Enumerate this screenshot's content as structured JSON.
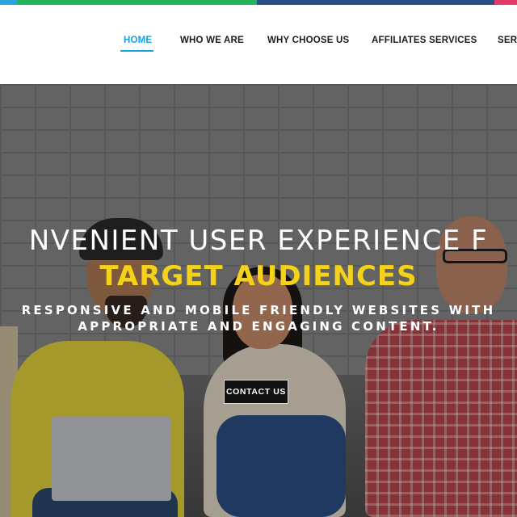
{
  "nav": {
    "items": [
      {
        "label": "HOME",
        "active": true
      },
      {
        "label": "WHO WE ARE",
        "active": false
      },
      {
        "label": "WHY CHOOSE US",
        "active": false
      },
      {
        "label": "AFFILIATES SERVICES",
        "active": false
      },
      {
        "label": "SERV",
        "active": false
      }
    ]
  },
  "hero": {
    "headline": "NVENIENT USER EXPERIENCE F",
    "highlight": "TARGET AUDIENCES",
    "subline1": "RESPONSIVE AND MOBILE FRIENDLY WEBSITES WITH",
    "subline2": "APPROPRIATE AND ENGAGING CONTENT.",
    "cta_label": "CONTACT US"
  },
  "colors": {
    "accent": "#12a3e0",
    "highlight": "#f5d21a",
    "strip": [
      "#2ba3dd",
      "#22b35a",
      "#2a4f86",
      "#e23a6b"
    ]
  }
}
